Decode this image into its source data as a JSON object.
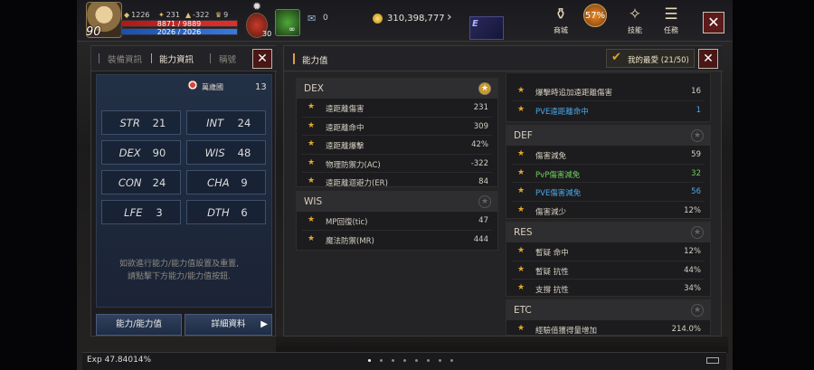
{
  "hud": {
    "level": "90",
    "stat_a": "1226",
    "stat_b": "231",
    "stat_c": "-322",
    "stat_d": "9",
    "hp": "8871 / 9889",
    "mp": "2026 / 2026",
    "potion_count": "30",
    "buff_count": "∞",
    "scroll_count": "0",
    "gold": "310,398,777",
    "menu": [
      {
        "label": "商城",
        "icon": "shop-icon"
      },
      {
        "label": "57%",
        "icon": "progress-icon"
      },
      {
        "label": "技能",
        "icon": "skill-icon"
      },
      {
        "label": "任務",
        "icon": "quest-icon"
      }
    ]
  },
  "left_panel": {
    "tabs": [
      "裝備資訊",
      "能力資訊",
      "稱號"
    ],
    "active_tab": "能力資訊",
    "faction_label": "萬歲國",
    "faction_value": "13",
    "stats": [
      {
        "name": "STR",
        "value": "21"
      },
      {
        "name": "INT",
        "value": "24"
      },
      {
        "name": "DEX",
        "value": "90"
      },
      {
        "name": "WIS",
        "value": "48"
      },
      {
        "name": "CON",
        "value": "24"
      },
      {
        "name": "CHA",
        "value": "9"
      },
      {
        "name": "LFE",
        "value": "3"
      },
      {
        "name": "DTH",
        "value": "6"
      }
    ],
    "info_line1": "如欲進行能力/能力值設置及重置,",
    "info_line2": "請點擊下方能力/能力值按鈕.",
    "btn_ability": "能力/能力值",
    "btn_detail": "詳細資料"
  },
  "right_panel": {
    "title": "能力值",
    "favorites": "我的最愛 (21/50)",
    "dex": {
      "title": "DEX",
      "rows": [
        {
          "label": "遠距離傷害",
          "value": "231"
        },
        {
          "label": "遠距離命中",
          "value": "309"
        },
        {
          "label": "遠距離爆擊",
          "value": "42%"
        },
        {
          "label": "物理防禦力(AC)",
          "value": "-322"
        },
        {
          "label": "遠距離迴避力(ER)",
          "value": "84"
        }
      ]
    },
    "wis": {
      "title": "WIS",
      "rows": [
        {
          "label": "MP回復(tic)",
          "value": "47"
        },
        {
          "label": "魔法防禦(MR)",
          "value": "444"
        }
      ]
    },
    "col2_top": {
      "rows": [
        {
          "label": "爆擊時追加遠距離傷害",
          "value": "16",
          "style": ""
        },
        {
          "label": "PVE遠距離命中",
          "value": "1",
          "style": "blue"
        }
      ]
    },
    "def": {
      "title": "DEF",
      "rows": [
        {
          "label": "傷害減免",
          "value": "59",
          "style": ""
        },
        {
          "label": "PvP傷害減免",
          "value": "32",
          "style": "green"
        },
        {
          "label": "PVE傷害減免",
          "value": "56",
          "style": "blue"
        },
        {
          "label": "傷害減少",
          "value": "12%",
          "style": ""
        }
      ]
    },
    "res": {
      "title": "RES",
      "rows": [
        {
          "label": "暫疑 命中",
          "value": "12%"
        },
        {
          "label": "暫疑 抗性",
          "value": "44%"
        },
        {
          "label": "支撐 抗性",
          "value": "34%"
        }
      ]
    },
    "etc": {
      "title": "ETC",
      "rows": [
        {
          "label": "經驗值獲得量增加",
          "value": "214.0%"
        }
      ]
    }
  },
  "exp": "Exp  47.84014%"
}
